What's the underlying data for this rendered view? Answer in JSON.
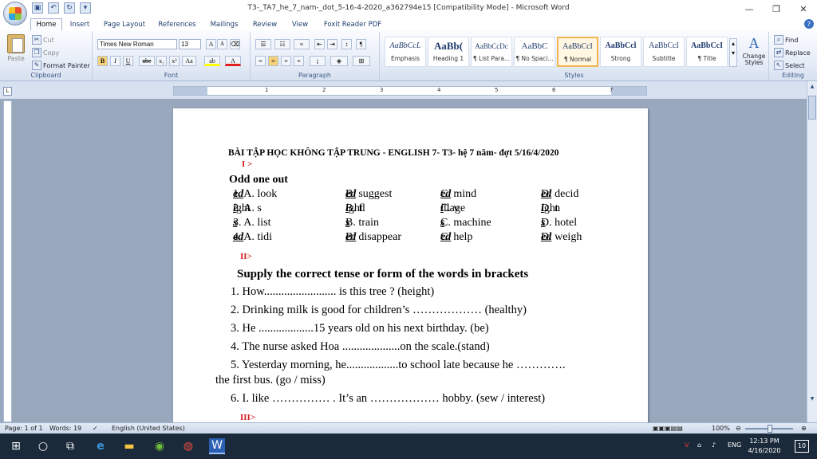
{
  "window": {
    "title": "T3-_TA7_he_7_nam-_dot_5-16-4-2020_a362794e15 [Compatibility Mode] - Microsoft Word",
    "minimize": "—",
    "restore": "❐",
    "close": "✕"
  },
  "tabs": [
    "Home",
    "Insert",
    "Page Layout",
    "References",
    "Mailings",
    "Review",
    "View",
    "Foxit Reader PDF"
  ],
  "clipboard": {
    "paste": "Paste",
    "cut": "Cut",
    "copy": "Copy",
    "format_painter": "Format Painter",
    "label": "Clipboard"
  },
  "font": {
    "name": "Times New Roman",
    "size": "13",
    "label": "Font",
    "bold": "B",
    "italic": "I",
    "underline": "U",
    "strike": "abe",
    "sub": "x₂",
    "sup": "x²",
    "case": "Aa"
  },
  "paragraph": {
    "label": "Paragraph"
  },
  "styles": {
    "label": "Styles",
    "change": "Change Styles",
    "tiles": [
      {
        "preview": "AaBbCcL",
        "name": "Emphasis"
      },
      {
        "preview": "AaBb(",
        "name": "Heading 1"
      },
      {
        "preview": "AaBbCcDc",
        "name": "¶ List Para..."
      },
      {
        "preview": "AaBbC",
        "name": "¶ No Spaci..."
      },
      {
        "preview": "AaBbCcI",
        "name": "¶ Normal"
      },
      {
        "preview": "AaBbCcl",
        "name": "Strong"
      },
      {
        "preview": "AaBbCcI",
        "name": "Subtitle"
      },
      {
        "preview": "AaBbCcI",
        "name": "¶ Title"
      }
    ]
  },
  "editing": {
    "find": "Find",
    "replace": "Replace",
    "select": "Select",
    "label": "Editing"
  },
  "ruler": {
    "numbers": [
      "1",
      "2",
      "3",
      "4",
      "5",
      "6",
      "7"
    ]
  },
  "document": {
    "title": "BÀI TẬP HỌC KHÔNG TẬP TRUNG - ENGLISH  7- T3- hệ 7 năm- đợt 5/16/4/2020",
    "section1": "I >",
    "heading1": "Odd one out",
    "odd_rows": [
      [
        {
          "pre": "1. A. look",
          "u": "ed",
          "post": ""
        },
        {
          "pre": "B. suggest",
          "u": "ed",
          "post": ""
        },
        {
          "pre": "C. mind",
          "u": "ed",
          "post": ""
        },
        {
          "pre": "D. decid",
          "u": "ed",
          "post": ""
        }
      ],
      [
        {
          "pre": "2. A. s",
          "u": "i",
          "post": "ght"
        },
        {
          "pre": "B. fl",
          "u": "i",
          "post": "ght"
        },
        {
          "pre": "C. v",
          "u": "i",
          "post": "llage"
        },
        {
          "pre": "D. n",
          "u": "i",
          "post": "ght"
        }
      ],
      [
        {
          "pre": "3. A. list",
          "u": "s",
          "post": ""
        },
        {
          "pre": "B. train",
          "u": "s",
          "post": ""
        },
        {
          "pre": "C. machine",
          "u": "s",
          "post": ""
        },
        {
          "pre": "D. hotel",
          "u": "s",
          "post": ""
        }
      ],
      [
        {
          "pre": "4. A. tidi",
          "u": "ed",
          "post": ""
        },
        {
          "pre": "B. disappear",
          "u": "ed",
          "post": ""
        },
        {
          "pre": "C. help",
          "u": "ed",
          "post": ""
        },
        {
          "pre": "D. weigh",
          "u": "ed",
          "post": ""
        }
      ]
    ],
    "section2": "II>",
    "heading2": "Supply the correct tense or form of the words in brackets",
    "questions": [
      "1. How......................... is this tree ? (height)",
      "2. Drinking milk is good for children’s ……………… (healthy)",
      "3. He ...................15 years old on his next birthday. (be)",
      "4. The nurse asked Hoa ....................on the scale.(stand)",
      "5. Yesterday morning, he..................to school late because he ………….",
      "the first bus. (go / miss)",
      "6. I. like …………… . It’s an ……………… hobby. (sew / interest)"
    ],
    "section3": "III>"
  },
  "status": {
    "page": "Page: 1 of 1",
    "words": "Words: 19",
    "language": "English (United States)",
    "zoom": "100%"
  },
  "taskbar": {
    "lang": "ENG",
    "time": "12:13 PM",
    "date": "4/16/2020",
    "notif": "10"
  }
}
